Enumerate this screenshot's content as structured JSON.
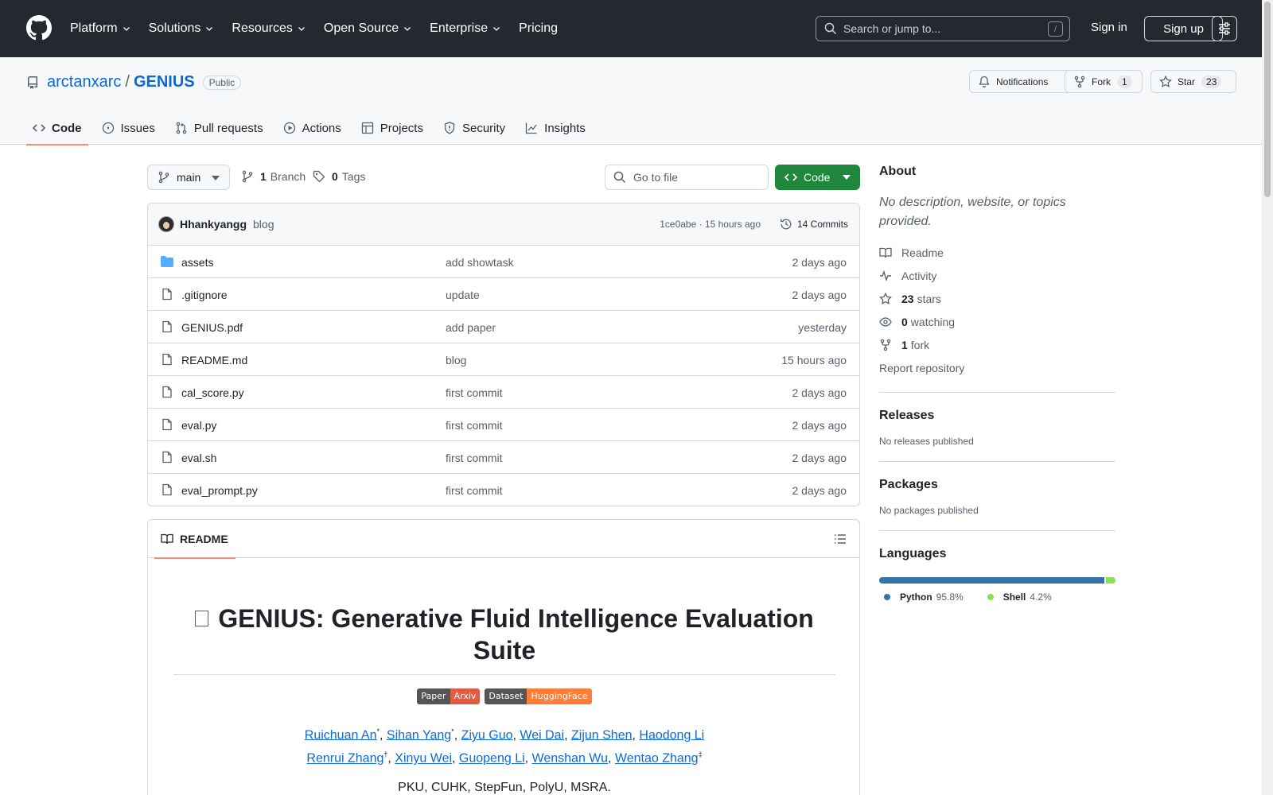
{
  "nav": {
    "items": [
      {
        "label": "Platform",
        "dropdown": true
      },
      {
        "label": "Solutions",
        "dropdown": true
      },
      {
        "label": "Resources",
        "dropdown": true
      },
      {
        "label": "Open Source",
        "dropdown": true
      },
      {
        "label": "Enterprise",
        "dropdown": true
      },
      {
        "label": "Pricing",
        "dropdown": false
      }
    ],
    "search_placeholder": "Search or jump to...",
    "search_shortcut": "/",
    "sign_in": "Sign in",
    "sign_up": "Sign up"
  },
  "repo": {
    "owner": "arctanxarc",
    "separator": "/",
    "name": "GENIUS",
    "visibility": "Public",
    "notifications_label": "Notifications",
    "fork_label": "Fork",
    "fork_count": "1",
    "star_label": "Star",
    "star_count": "23"
  },
  "tabs": [
    {
      "label": "Code",
      "icon": "code-icon",
      "active": true
    },
    {
      "label": "Issues",
      "icon": "issue-icon"
    },
    {
      "label": "Pull requests",
      "icon": "pull-request-icon"
    },
    {
      "label": "Actions",
      "icon": "play-icon"
    },
    {
      "label": "Projects",
      "icon": "table-icon"
    },
    {
      "label": "Security",
      "icon": "shield-icon"
    },
    {
      "label": "Insights",
      "icon": "graph-icon"
    }
  ],
  "toolbar": {
    "branch": "main",
    "branch_count": "1",
    "branch_label": "Branch",
    "tag_count": "0",
    "tag_label": "Tags",
    "goto_placeholder": "Go to file",
    "code_button": "Code"
  },
  "commit": {
    "author": "Hhankyangg",
    "message": "blog",
    "hash_time": "1ce0abe · 15 hours ago",
    "commits_label": "14 Commits"
  },
  "files": [
    {
      "name": "assets",
      "type": "folder",
      "message": "add showtask",
      "date": "2 days ago"
    },
    {
      "name": ".gitignore",
      "type": "file",
      "message": "update",
      "date": "2 days ago"
    },
    {
      "name": "GENIUS.pdf",
      "type": "file",
      "message": "add paper",
      "date": "yesterday"
    },
    {
      "name": "README.md",
      "type": "file",
      "message": "blog",
      "date": "15 hours ago"
    },
    {
      "name": "cal_score.py",
      "type": "file",
      "message": "first commit",
      "date": "2 days ago"
    },
    {
      "name": "eval.py",
      "type": "file",
      "message": "first commit",
      "date": "2 days ago"
    },
    {
      "name": "eval.sh",
      "type": "file",
      "message": "first commit",
      "date": "2 days ago"
    },
    {
      "name": "eval_prompt.py",
      "type": "file",
      "message": "first commit",
      "date": "2 days ago"
    }
  ],
  "readme": {
    "tab_label": "README",
    "title": "GENIUS: Generative Fluid Intelligence Evaluation Suite",
    "shields": [
      {
        "left": "Paper",
        "right": "Arxiv",
        "color": "#e05d44"
      },
      {
        "left": "Dataset",
        "right": "HuggingFace",
        "color": "#fe7d37"
      }
    ],
    "authors_line1": [
      {
        "name": "Ruichuan An",
        "mark": "*"
      },
      {
        "name": "Sihan Yang",
        "mark": "*"
      },
      {
        "name": "Ziyu Guo",
        "mark": ""
      },
      {
        "name": "Wei Dai",
        "mark": ""
      },
      {
        "name": "Zijun Shen",
        "mark": ""
      },
      {
        "name": "Haodong Li",
        "mark": ""
      }
    ],
    "authors_line2": [
      {
        "name": "Renrui Zhang",
        "mark": "†"
      },
      {
        "name": "Xinyu Wei",
        "mark": ""
      },
      {
        "name": "Guopeng Li",
        "mark": ""
      },
      {
        "name": "Wenshan Wu",
        "mark": ""
      },
      {
        "name": "Wentao Zhang",
        "mark": "‡"
      }
    ],
    "affiliations": "PKU, CUHK, StepFun, PolyU, MSRA."
  },
  "sidebar": {
    "about_title": "About",
    "about_desc": "No description, website, or topics provided.",
    "readme_link": "Readme",
    "activity_link": "Activity",
    "stars_count": "23",
    "stars_label": "stars",
    "watching_count": "0",
    "watching_label": "watching",
    "forks_count": "1",
    "forks_label": "fork",
    "report": "Report repository",
    "releases_title": "Releases",
    "releases_sub": "No releases published",
    "packages_title": "Packages",
    "packages_sub": "No packages published",
    "languages_title": "Languages",
    "languages": [
      {
        "name": "Python",
        "percent": "95.8%",
        "value": 95.8,
        "color": "#3572A5"
      },
      {
        "name": "Shell",
        "percent": "4.2%",
        "value": 4.2,
        "color": "#89e051"
      }
    ]
  }
}
